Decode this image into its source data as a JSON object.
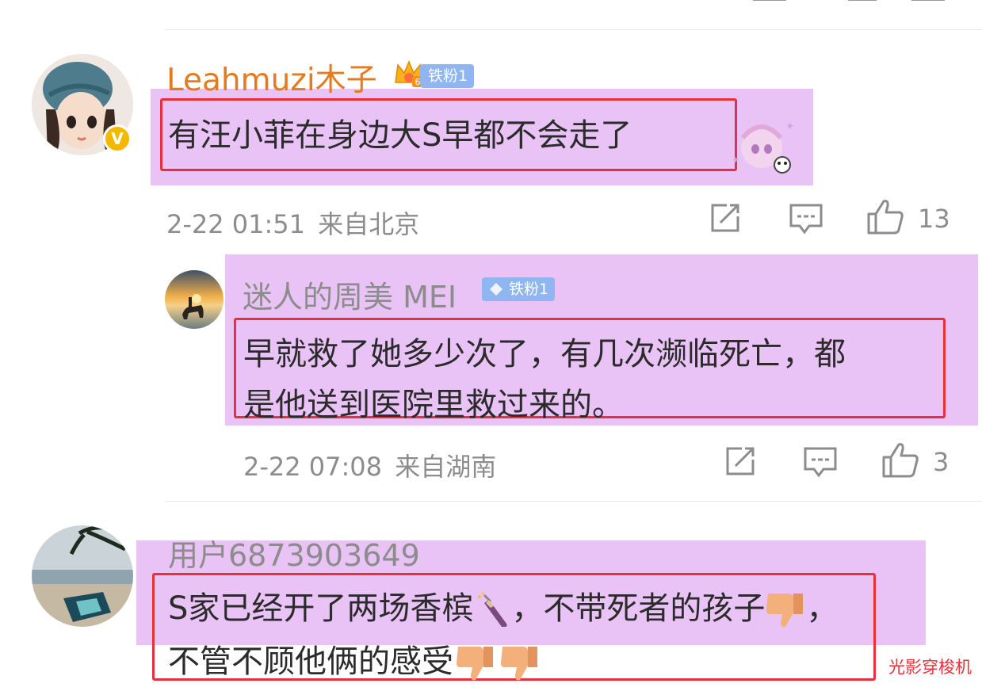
{
  "comments": [
    {
      "author": "Leahmuzi木子",
      "badge_label": "铁粉1",
      "badge_level": "6",
      "text": "有汪小菲在身边大S早都不会走了",
      "date": "2-22 01:51",
      "location": "来自北京",
      "likes": "13"
    },
    {
      "author": "迷人的周美 MEI",
      "badge_label": "铁粉1",
      "text_line1": "早就救了她多少次了，有几次濒临死亡，都",
      "text_line2": "是他送到医院里救过来的。",
      "date": "2-22 07:08",
      "location": "来自湖南",
      "likes": "3"
    },
    {
      "author": "用户6873903649",
      "text_part1": "S家已经开了两场香槟",
      "text_part2": "，不带死者的孩子",
      "text_part3": "，",
      "text_line2": "不管不顾他俩的感受"
    }
  ],
  "watermark": "光影穿梭机",
  "icons": [
    "share-icon",
    "comment-icon",
    "thumbs-up-icon",
    "champagne-emoji",
    "thumbs-down-emoji",
    "verified-v-icon",
    "crown-icon",
    "diamond-icon"
  ],
  "colors": {
    "highlight": "#e9c3f6",
    "annotation_red": "#e8303a",
    "author_orange": "#e67a1f",
    "author_gray": "#8c8c8c",
    "badge_blue": "#8fb6f0",
    "verified_gold": "#f5b800"
  }
}
